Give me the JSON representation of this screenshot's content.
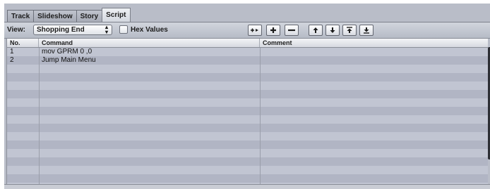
{
  "tabs": [
    {
      "label": "Track",
      "active": false
    },
    {
      "label": "Slideshow",
      "active": false
    },
    {
      "label": "Story",
      "active": false
    },
    {
      "label": "Script",
      "active": true
    }
  ],
  "toolbar": {
    "view_label": "View:",
    "view_value": "Shopping End",
    "hex_label": "Hex Values",
    "hex_checked": false,
    "buttons": [
      {
        "icon": "insert-before-icon"
      },
      {
        "icon": "plus-icon"
      },
      {
        "icon": "minus-icon"
      },
      {
        "icon": "arrow-up-icon"
      },
      {
        "icon": "arrow-down-icon"
      },
      {
        "icon": "move-to-top-icon"
      },
      {
        "icon": "move-to-bottom-icon"
      }
    ]
  },
  "table": {
    "columns": [
      "No.",
      "Command",
      "Comment"
    ],
    "rows": [
      {
        "no": "1",
        "command": "mov GPRM 0 ,0",
        "comment": ""
      },
      {
        "no": "2",
        "command": "Jump Main Menu",
        "comment": ""
      }
    ]
  },
  "colors": {
    "row_odd": "#c1c5d2",
    "row_even": "#b1b5c4",
    "chrome": "#b9bdc8"
  }
}
